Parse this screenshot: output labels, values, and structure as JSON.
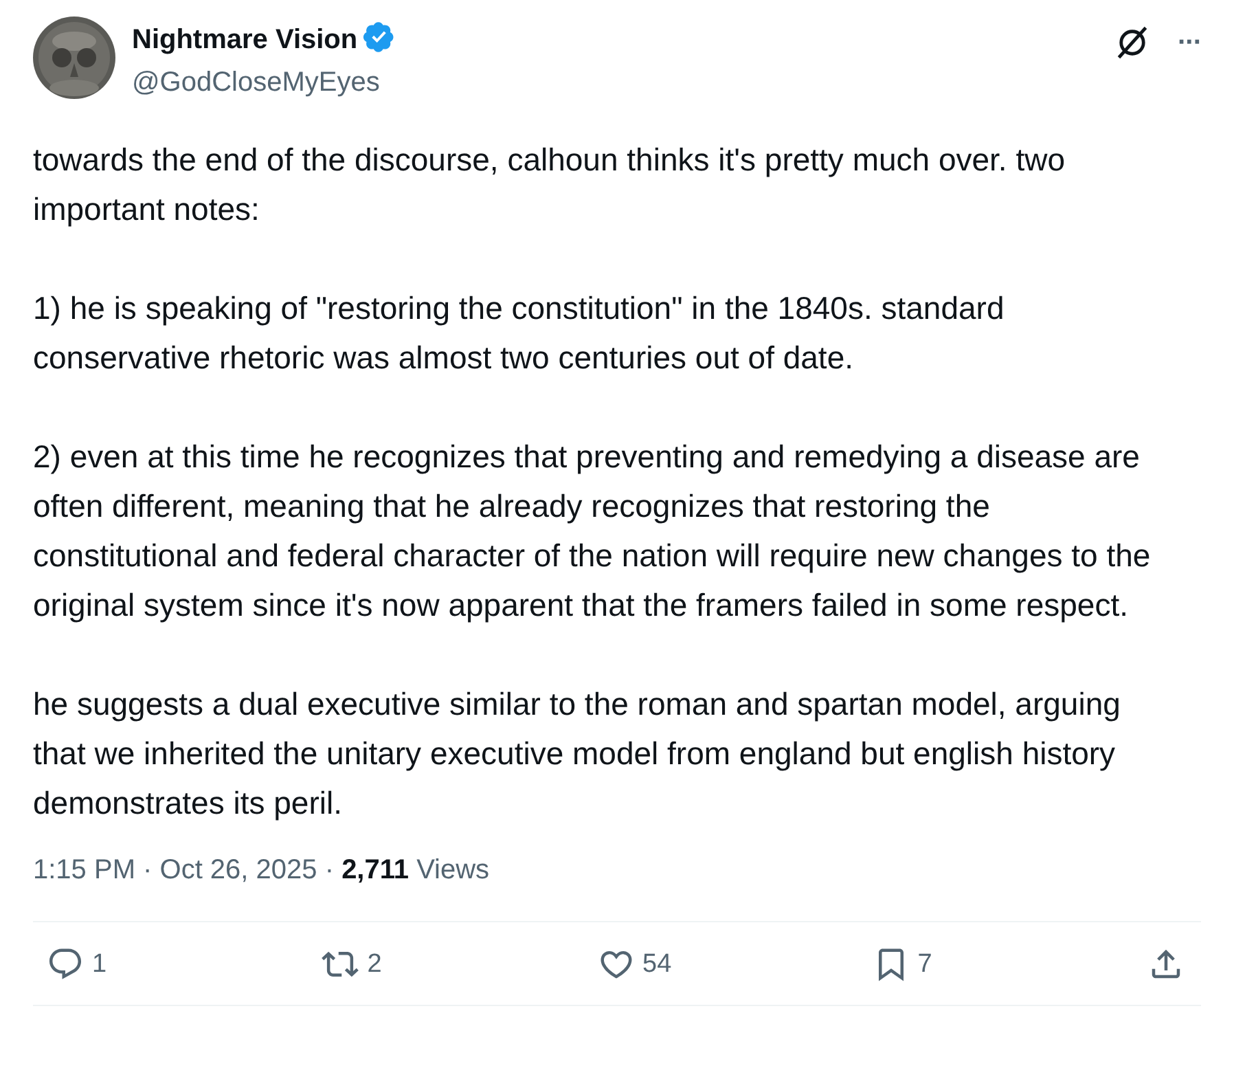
{
  "author": {
    "name": "Nightmare Vision",
    "verified": true,
    "handle": "@GodCloseMyEyes"
  },
  "header_actions": [
    {
      "kind": "grok"
    },
    {
      "kind": "more",
      "label": "···"
    }
  ],
  "paragraphs": [
    "towards the end of the discourse, calhoun thinks it's pretty much over. two important notes:",
    "1) he is speaking of \"restoring the constitution\" in the 1840s. standard conservative rhetoric was almost two centuries out of date.",
    "2) even at this time he recognizes that preventing and remedying a disease are often different, meaning that he already recognizes that restoring the constitutional and federal character of the nation will require new changes to the original system since it's now apparent that the framers failed in some respect.",
    "he suggests a dual executive similar to the roman and spartan model, arguing that we inherited the unitary executive model from england but english history demonstrates its peril."
  ],
  "meta": "1:15 PM · Oct 26, 2025 · **2,711** Views",
  "actions": [
    {
      "kind": "reply",
      "count": "1"
    },
    {
      "kind": "repost",
      "count": "2"
    },
    {
      "kind": "like",
      "count": "54"
    },
    {
      "kind": "bookmark",
      "count": "7"
    },
    {
      "kind": "share"
    }
  ]
}
